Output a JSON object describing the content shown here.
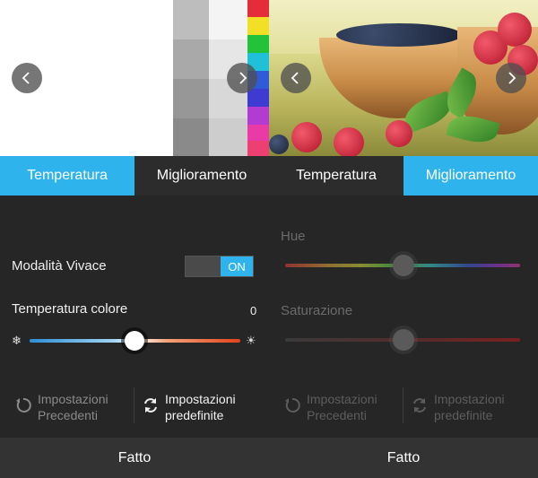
{
  "left": {
    "tabs": [
      "Temperatura",
      "Miglioramento"
    ],
    "active_tab": 0,
    "vivid_mode": {
      "label": "Modalità Vivace",
      "state": "ON"
    },
    "color_temperature": {
      "label": "Temperatura colore",
      "value": "0",
      "level": 0.5
    },
    "actions": {
      "previous": "Impostazioni\nPrecedenti",
      "default": "Impostazioni\npredefinite"
    },
    "done": "Fatto"
  },
  "right": {
    "tabs": [
      "Temperatura",
      "Miglioramento"
    ],
    "active_tab": 1,
    "hue": {
      "label": "Hue",
      "level": 0.5
    },
    "saturation": {
      "label": "Saturazione",
      "level": 0.5
    },
    "actions": {
      "previous": "Impostazioni\nPrecedenti",
      "default": "Impostazioni\npredefinite"
    },
    "done": "Fatto"
  },
  "colors": {
    "accent": "#2fb3ec",
    "panel": "#262626",
    "footer": "#333333"
  },
  "icons": [
    "chevron-left-icon",
    "chevron-right-icon",
    "reset-icon",
    "refresh-icon",
    "snowflake-icon",
    "sun-icon"
  ]
}
